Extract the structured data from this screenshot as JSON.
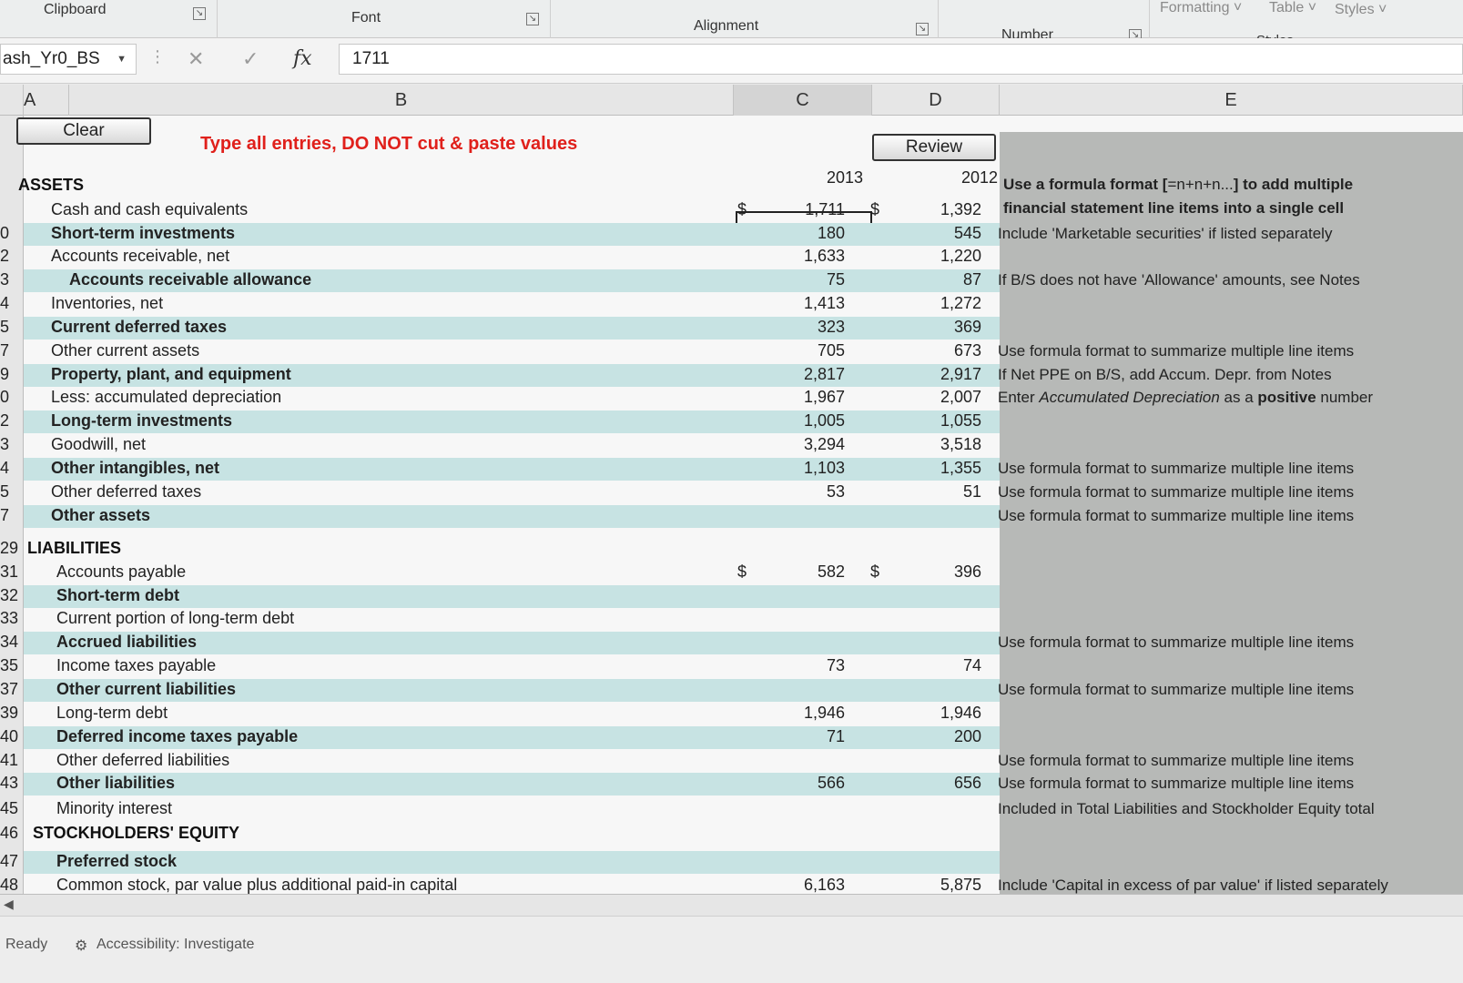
{
  "ribbon": {
    "groups": [
      "Clipboard",
      "Font",
      "Alignment",
      "Number",
      "Styles"
    ],
    "styles_items": [
      "Formatting",
      "Table",
      "Styles"
    ]
  },
  "formula_bar": {
    "name_box": "ash_Yr0_BS",
    "fx_label": "fx",
    "formula_value": "1711"
  },
  "columns": [
    "A",
    "B",
    "C",
    "D",
    "E"
  ],
  "sheet": {
    "clear_label": "Clear",
    "review_label": "Review",
    "instruction": "Type all entries, DO NOT cut & paste values",
    "year_2013": "2013",
    "year_2012": "2012",
    "sections": {
      "assets": "ASSETS",
      "liabilities": "LIABILITIES",
      "equity": "STOCKHOLDERS' EQUITY"
    },
    "rows": [
      {
        "num": "",
        "label": "Cash and cash equivalents",
        "cur13": "$",
        "v13": "1,711",
        "cur12": "$",
        "v12": "1,392"
      },
      {
        "num": "0",
        "label": "Short-term investments",
        "v13": "180",
        "v12": "545",
        "note": "Include 'Marketable securities' if listed separately"
      },
      {
        "num": "2",
        "label": "Accounts receivable, net",
        "v13": "1,633",
        "v12": "1,220"
      },
      {
        "num": "3",
        "label": "Accounts receivable allowance",
        "v13": "75",
        "v12": "87",
        "note": "If B/S does not have 'Allowance' amounts, see Notes"
      },
      {
        "num": "4",
        "label": "Inventories, net",
        "v13": "1,413",
        "v12": "1,272"
      },
      {
        "num": "5",
        "label": "Current deferred taxes",
        "v13": "323",
        "v12": "369"
      },
      {
        "num": "7",
        "label": "Other current assets",
        "v13": "705",
        "v12": "673",
        "note": "Use formula format to summarize multiple line items"
      },
      {
        "num": "9",
        "label": "Property, plant, and equipment",
        "v13": "2,817",
        "v12": "2,917",
        "note": "If Net PPE on B/S, add Accum. Depr. from Notes"
      },
      {
        "num": "0",
        "label": "Less:  accumulated depreciation",
        "v13": "1,967",
        "v12": "2,007",
        "note": "Enter Accumulated Depreciation as a positive number"
      },
      {
        "num": "2",
        "label": "Long-term investments",
        "v13": "1,005",
        "v12": "1,055"
      },
      {
        "num": "3",
        "label": "Goodwill, net",
        "v13": "3,294",
        "v12": "3,518"
      },
      {
        "num": "4",
        "label": "Other intangibles, net",
        "v13": "1,103",
        "v12": "1,355",
        "note": "Use formula format to summarize multiple line items"
      },
      {
        "num": "5",
        "label": "Other deferred taxes",
        "v13": "53",
        "v12": "51",
        "note": "Use formula format to summarize multiple line items"
      },
      {
        "num": "7",
        "label": "Other assets",
        "v13": "",
        "v12": "",
        "note": "Use formula format to summarize multiple line items"
      },
      {
        "num": "31",
        "label": "Accounts payable",
        "cur13": "$",
        "v13": "582",
        "cur12": "$",
        "v12": "396"
      },
      {
        "num": "32",
        "label": "Short-term debt",
        "v13": "",
        "v12": ""
      },
      {
        "num": "33",
        "label": "Current portion of long-term debt",
        "v13": "",
        "v12": ""
      },
      {
        "num": "34",
        "label": "Accrued liabilities",
        "v13": "",
        "v12": "",
        "note": "Use formula format to summarize multiple line items"
      },
      {
        "num": "35",
        "label": "Income taxes payable",
        "v13": "73",
        "v12": "74"
      },
      {
        "num": "37",
        "label": "Other current liabilities",
        "v13": "",
        "v12": "",
        "note": "Use formula format to summarize multiple line items"
      },
      {
        "num": "39",
        "label": "Long-term debt",
        "v13": "1,946",
        "v12": "1,946"
      },
      {
        "num": "40",
        "label": "Deferred income taxes payable",
        "v13": "71",
        "v12": "200"
      },
      {
        "num": "41",
        "label": "Other deferred liabilities",
        "v13": "",
        "v12": "",
        "note": "Use formula format to summarize multiple line items"
      },
      {
        "num": "43",
        "label": "Other liabilities",
        "v13": "566",
        "v12": "656",
        "note": "Use formula format to summarize multiple line items"
      },
      {
        "num": "45",
        "label": "Minority interest",
        "v13": "",
        "v12": "",
        "note": "Included in Total Liabilities and Stockholder Equity total"
      },
      {
        "num": "47",
        "label": "Preferred stock",
        "v13": "",
        "v12": ""
      },
      {
        "num": "48",
        "label": "Common stock, par value plus additional paid-in capital",
        "v13": "6,163",
        "v12": "5,875",
        "note": "Include 'Capital in excess of par value' if listed separately"
      }
    ],
    "section_row_nums": {
      "liabilities": "29",
      "equity": "46"
    },
    "top_note_bold_1": "Use a formula format [",
    "top_note_formula": "=n+n+n...",
    "top_note_bold_2": "] to add multiple",
    "top_note_line2": "financial statement line items into a single cell"
  },
  "status": {
    "ready": "Ready",
    "accessibility": "Accessibility: Investigate"
  },
  "colors": {
    "highlight_row": "#c7e3e3",
    "note_column": "#b7b9b7",
    "instruction_red": "#e0201b"
  }
}
